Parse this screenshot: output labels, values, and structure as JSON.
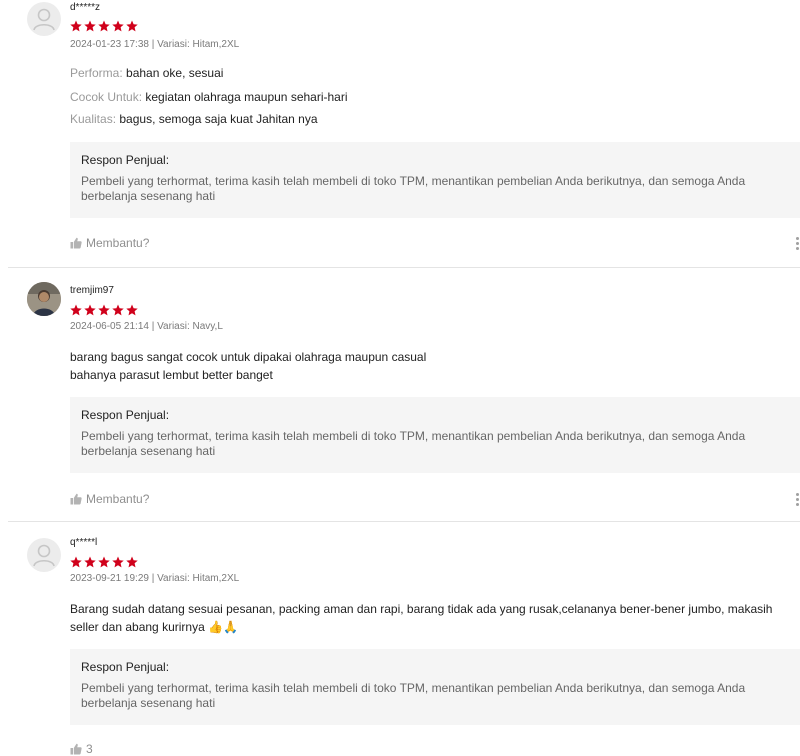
{
  "reviews": [
    {
      "username": "d*****z",
      "avatar": "default-user-icon",
      "rating": 5,
      "date": "2024-01-23 17:38",
      "variant": "Variasi: Hitam,2XL",
      "attributes": [
        {
          "label": "Performa:",
          "value": "bahan oke, sesuai"
        },
        {
          "label": "Cocok Untuk:",
          "value": "kegiatan olahraga maupun sehari-hari"
        },
        {
          "label": "Kualitas:",
          "value": "bagus, semoga saja kuat Jahitan nya"
        }
      ],
      "seller_title": "Respon Penjual:",
      "seller_msg": "Pembeli yang terhormat, terima kasih telah membeli di toko TPM, menantikan pembelian Anda berikutnya, dan semoga Anda berbelanja sesenang hati",
      "helpful": "Membantu?"
    },
    {
      "username": "tremjim97",
      "avatar": "profile-photo",
      "rating": 5,
      "date": "2024-06-05 21:14",
      "variant": "Variasi: Navy,L",
      "text_lines": [
        "barang bagus sangat cocok untuk dipakai olahraga maupun casual",
        "bahanya parasut lembut better banget"
      ],
      "seller_title": "Respon Penjual:",
      "seller_msg": "Pembeli yang terhormat, terima kasih telah membeli di toko TPM, menantikan pembelian Anda berikutnya, dan semoga Anda berbelanja sesenang hati",
      "helpful": "Membantu?"
    },
    {
      "username": "q*****l",
      "avatar": "default-user-icon",
      "rating": 5,
      "date": "2023-09-21 19:29",
      "variant": "Variasi: Hitam,2XL",
      "text": "Barang sudah datang sesuai pesanan, packing aman dan rapi, barang tidak ada yang rusak,celananya bener-bener jumbo, makasih seller dan abang kurirnya 👍🙏",
      "seller_title": "Respon Penjual:",
      "seller_msg": "Pembeli yang terhormat, terima kasih telah membeli di toko TPM, menantikan pembelian Anda berikutnya, dan semoga Anda berbelanja sesenang hati",
      "helpful": "3"
    }
  ],
  "colors": {
    "star": "#d0011b",
    "seller_bg": "#f5f5f5",
    "muted": "#8f8f8f"
  }
}
